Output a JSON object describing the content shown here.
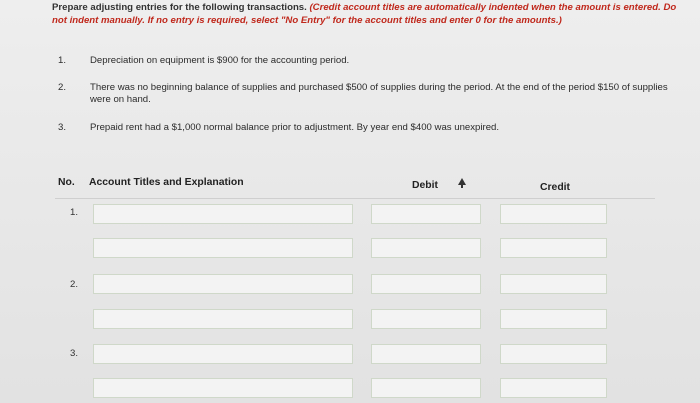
{
  "instructions": {
    "main": "Prepare adjusting entries for the following transactions.",
    "note": "(Credit account titles are automatically indented when the amount is entered. Do not indent manually. If no entry is required, select \"No Entry\" for the account titles and enter 0 for the amounts.)"
  },
  "transactions": [
    {
      "num": "1.",
      "text": "Depreciation on equipment is $900 for the accounting period."
    },
    {
      "num": "2.",
      "text": "There was no beginning balance of supplies and purchased $500 of supplies during the period. At the end of the period $150 of supplies were on hand."
    },
    {
      "num": "3.",
      "text": "Prepaid rent had a $1,000 normal balance prior to adjustment. By year end $400 was unexpired."
    }
  ],
  "table": {
    "col_no": "No.",
    "col_account": "Account Titles and Explanation",
    "col_debit": "Debit",
    "col_credit": "Credit",
    "row_numbers": [
      "1.",
      "2.",
      "3."
    ]
  }
}
